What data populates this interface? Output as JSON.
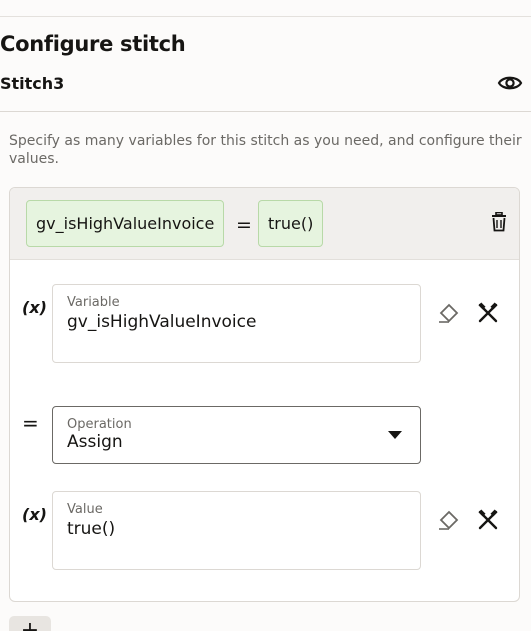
{
  "header": {
    "title": "Configure stitch",
    "stitch_name": "Stitch3"
  },
  "description": "Specify as many variables for this stitch as you need, and configure their values.",
  "summary": {
    "variable": "gv_isHighValueInvoice",
    "operator": "=",
    "value": "true()"
  },
  "variable_field": {
    "prefix": "(x)",
    "label": "Variable",
    "value": "gv_isHighValueInvoice"
  },
  "operation_field": {
    "prefix": "=",
    "label": "Operation",
    "value": "Assign"
  },
  "value_field": {
    "prefix": "(x)",
    "label": "Value",
    "value": "true()"
  },
  "add_button": {
    "label": "+"
  }
}
